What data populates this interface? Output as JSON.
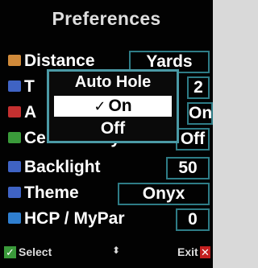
{
  "title": "Preferences",
  "settings": [
    {
      "label": "Distance",
      "value": "Yards",
      "icon": "ruler-icon",
      "icon_color": "#d08a3a"
    },
    {
      "label": "T",
      "value": "2",
      "icon": "magnifier-icon",
      "icon_color": "#3f63c4"
    },
    {
      "label": "A",
      "value": "On",
      "icon": "golf-hole-icon",
      "icon_color": "#c43030"
    },
    {
      "label": "Center Only",
      "value": "Off",
      "icon": "center-icon",
      "icon_color": "#3a9a3a"
    },
    {
      "label": "Backlight",
      "value": "50",
      "icon": "bulb-icon",
      "icon_color": "#3f63c4"
    },
    {
      "label": "Theme",
      "value": "Onyx",
      "icon": "theme-icon",
      "icon_color": "#3f63c4"
    },
    {
      "label": "HCP / MyPar",
      "value": "0",
      "icon": "player-icon",
      "icon_color": "#2f7fd0"
    }
  ],
  "popup": {
    "title": "Auto Hole",
    "options": [
      "On",
      "Off"
    ],
    "selected": "On"
  },
  "footer": {
    "select_label": "Select",
    "exit_label": "Exit",
    "nav_icon": "up-down-arrows-icon"
  },
  "colors": {
    "background": "#020202",
    "box_border": "#2e7c86",
    "popup_border": "#4b9aa6",
    "select_green": "#3a9a3a",
    "exit_red": "#c42020"
  }
}
